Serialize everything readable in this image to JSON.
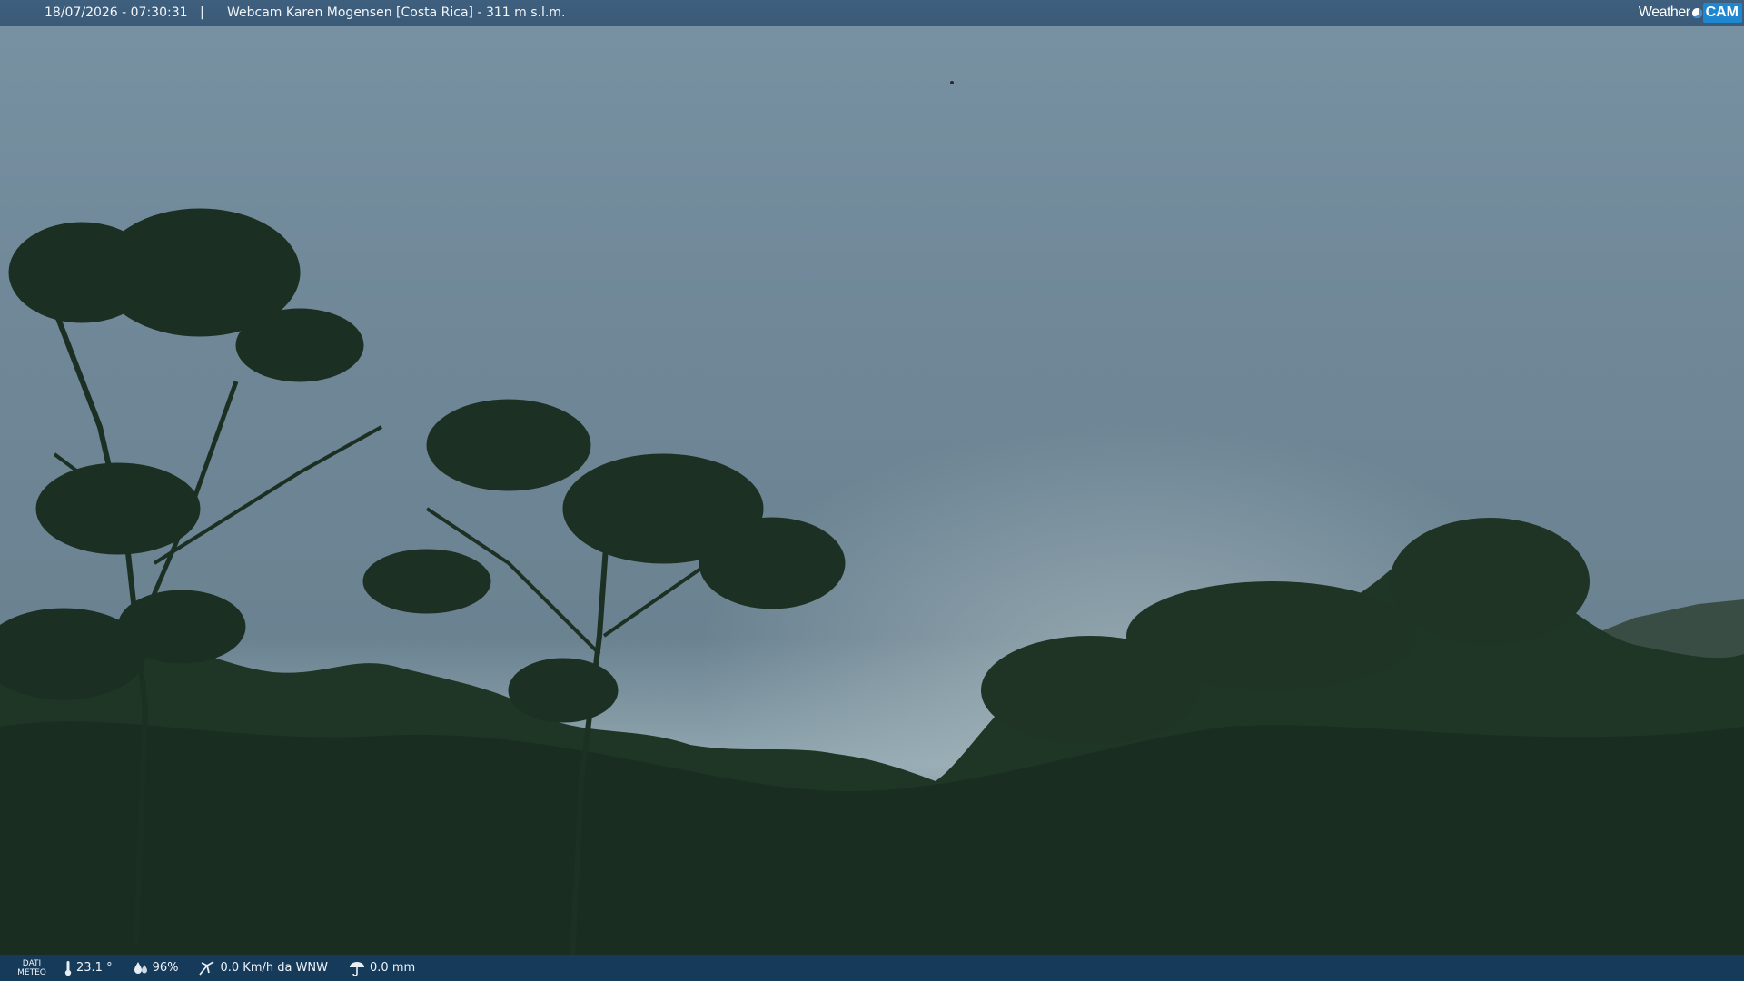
{
  "header": {
    "datetime": "18/07/2026 - 07:30:31",
    "separator": "|",
    "camera_title": "Webcam Karen Mogensen [Costa Rica]  - 311 m s.l.m."
  },
  "logo": {
    "word": "Weather",
    "badge": "CAM"
  },
  "meteo": {
    "label_line1": "DATI",
    "label_line2": "METEO",
    "temperature": "23.1 °",
    "humidity": "96%",
    "wind": "0.0 Km/h da WNW",
    "rain": "0.0 mm"
  },
  "colors": {
    "sky": "#6f8799",
    "foliage": "#1f3526",
    "bar": "#1c4e7c"
  },
  "icons": [
    "thermometer-icon",
    "humidity-icon",
    "wind-icon",
    "rain-icon"
  ]
}
